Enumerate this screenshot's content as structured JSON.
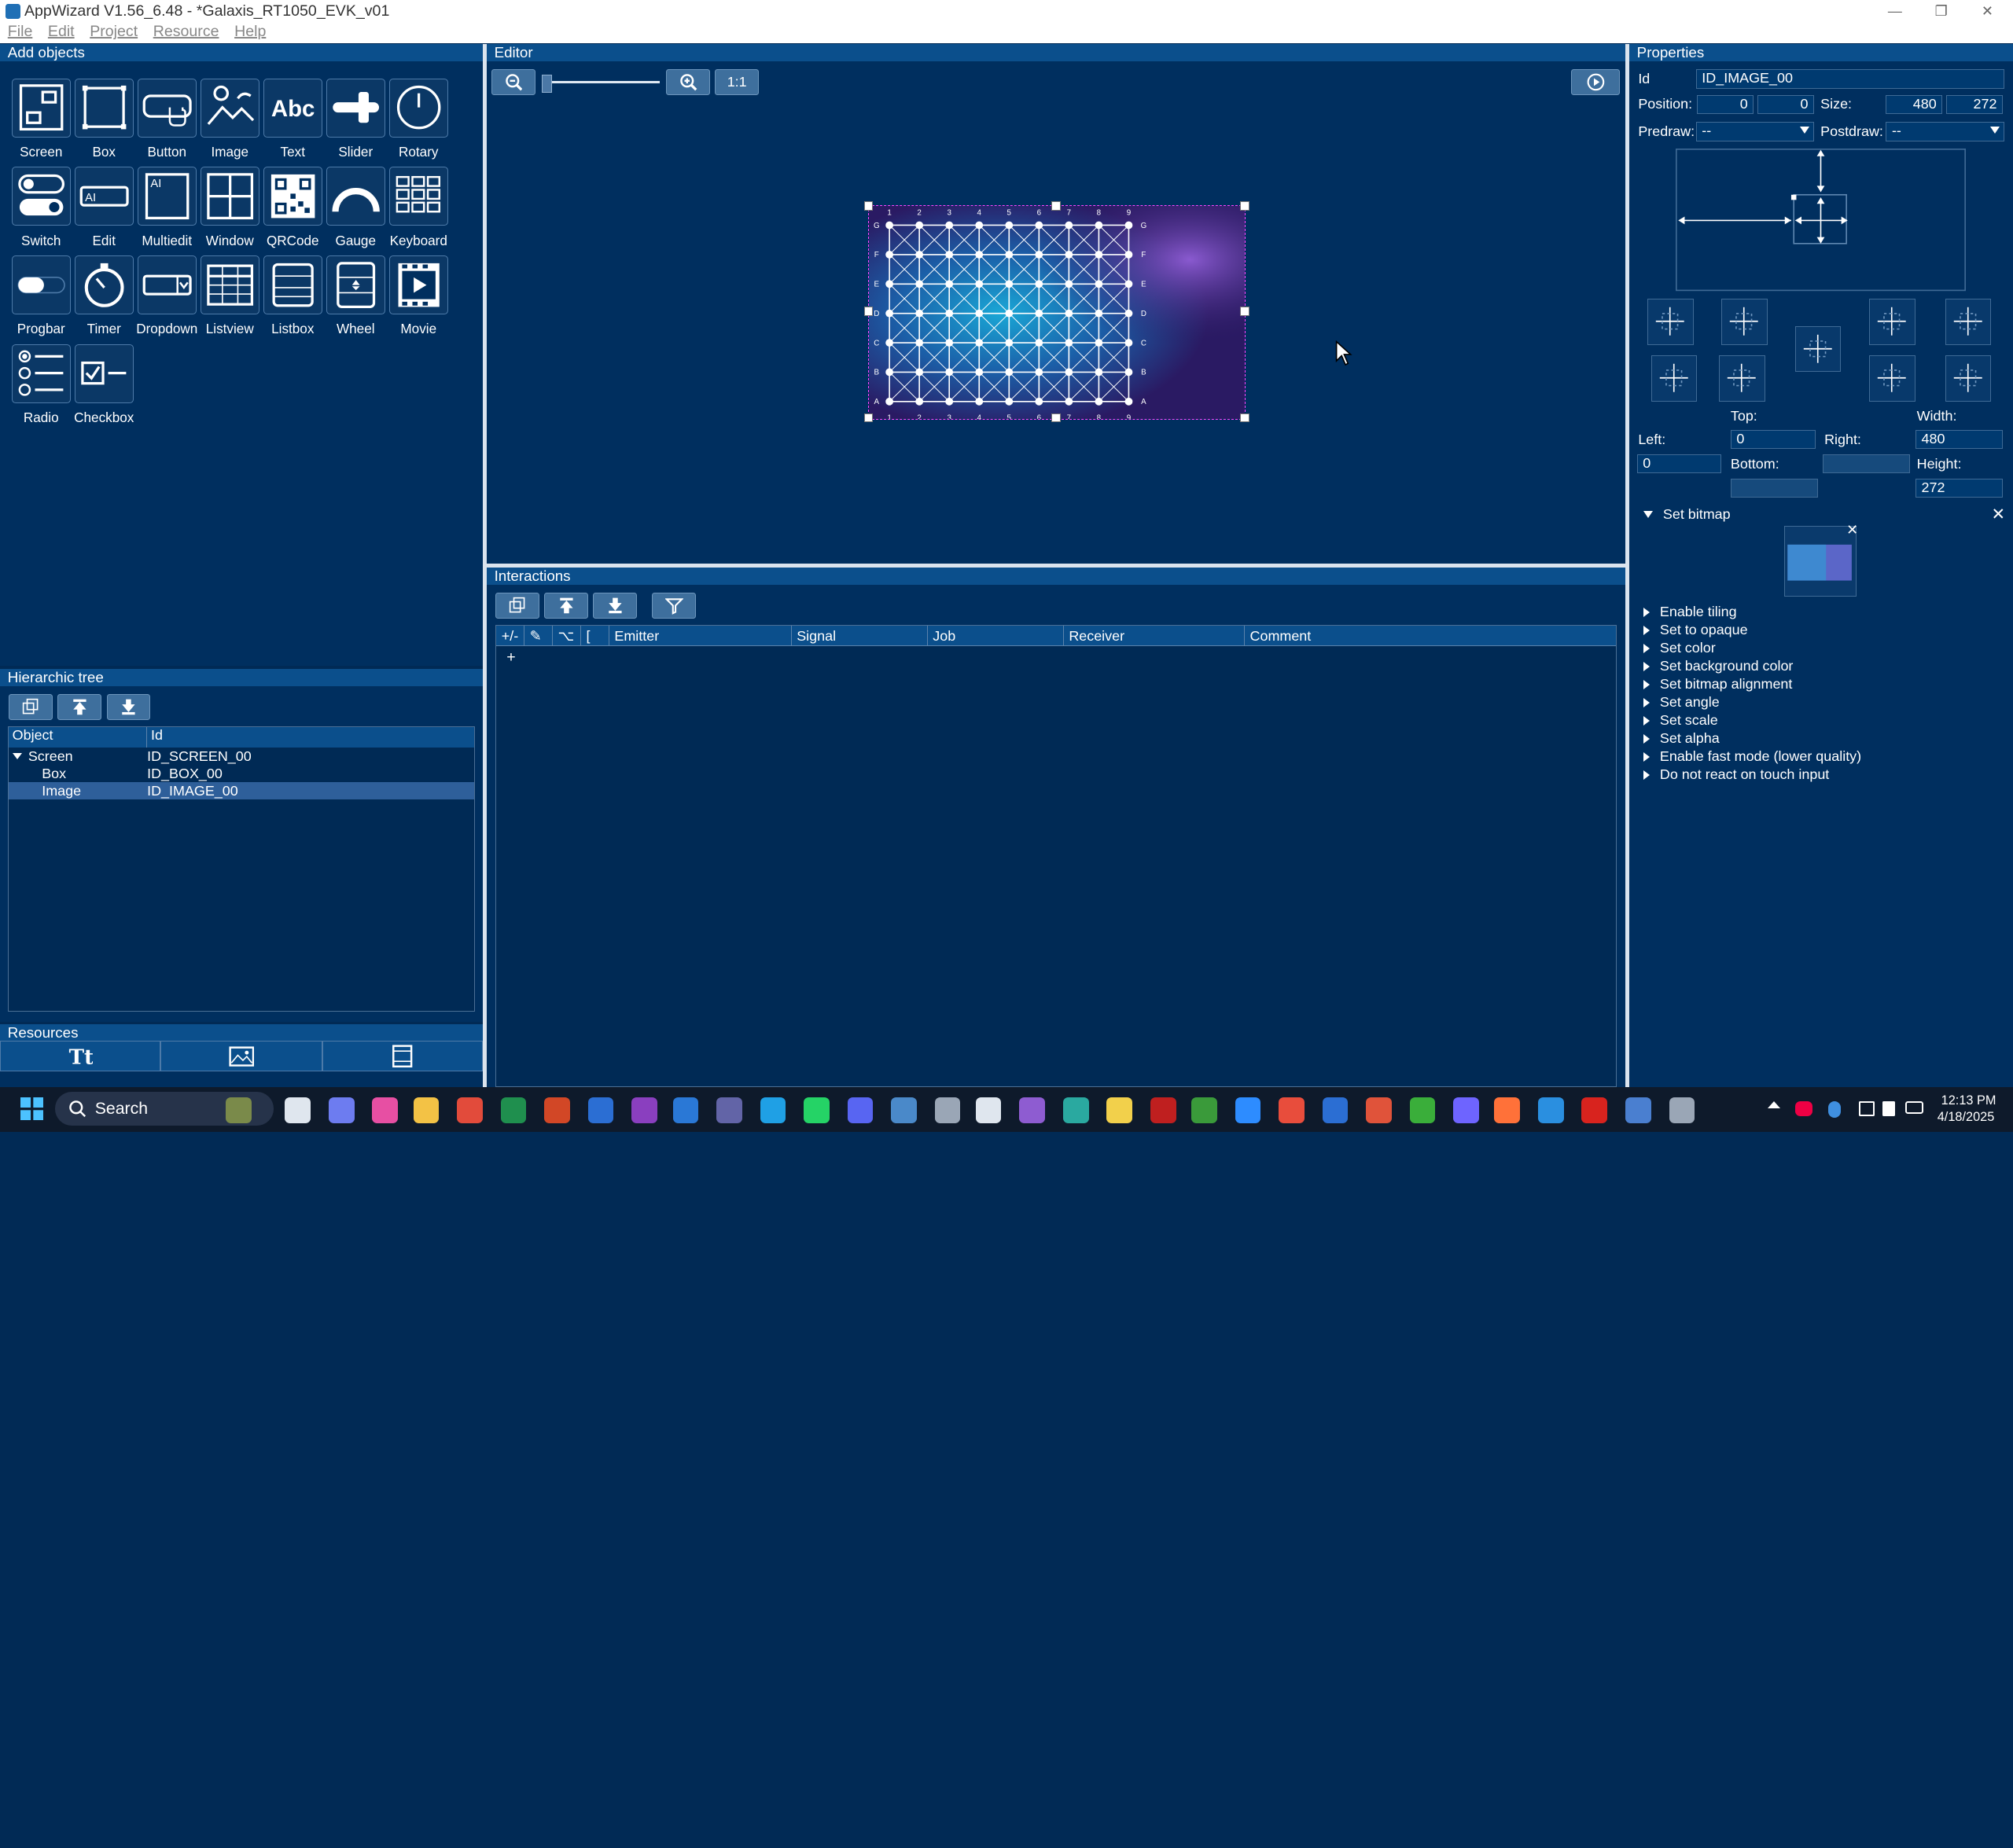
{
  "window": {
    "title": "AppWizard V1.56_6.48 - *Galaxis_RT1050_EVK_v01",
    "min": "—",
    "max": "❐",
    "close": "✕"
  },
  "menu": [
    "File",
    "Edit",
    "Project",
    "Resource",
    "Help"
  ],
  "add_objects": {
    "title": "Add objects",
    "tools": [
      "Screen",
      "Box",
      "Button",
      "Image",
      "Text",
      "Slider",
      "Rotary",
      "Switch",
      "Edit",
      "Multiedit",
      "Window",
      "QRCode",
      "Gauge",
      "Keyboard",
      "Progbar",
      "Timer",
      "Dropdown",
      "Listview",
      "Listbox",
      "Wheel",
      "Movie",
      "Radio",
      "Checkbox"
    ]
  },
  "tree": {
    "title": "Hierarchic tree",
    "cols": [
      "Object",
      "Id"
    ],
    "rows": [
      {
        "object": "Screen",
        "id": "ID_SCREEN_00",
        "expanded": true
      },
      {
        "object": "Box",
        "id": "ID_BOX_00"
      },
      {
        "object": "Image",
        "id": "ID_IMAGE_00",
        "selected": true
      }
    ]
  },
  "resources": {
    "title": "Resources"
  },
  "editor": {
    "title": "Editor",
    "zoom_reset": "1:1",
    "grid_cols": [
      "1",
      "2",
      "3",
      "4",
      "5",
      "6",
      "7",
      "8",
      "9"
    ],
    "grid_rows": [
      "G",
      "F",
      "E",
      "D",
      "C",
      "B",
      "A"
    ]
  },
  "interactions": {
    "title": "Interactions",
    "cols": [
      "+/-",
      "✎",
      "⌥",
      "[",
      "Emitter",
      "Signal",
      "Job",
      "Receiver",
      "Comment"
    ],
    "add_row": "+"
  },
  "properties": {
    "title": "Properties",
    "id_label": "Id",
    "id_value": "ID_IMAGE_00",
    "position_label": "Position:",
    "pos_x": "0",
    "pos_y": "0",
    "size_label": "Size:",
    "size_w": "480",
    "size_h": "272",
    "predraw_label": "Predraw:",
    "predraw_value": "--",
    "postdraw_label": "Postdraw:",
    "postdraw_value": "--",
    "top_label": "Top:",
    "left_label": "Left:",
    "right_label": "Right:",
    "bottom_label": "Bottom:",
    "width_label": "Width:",
    "height_label": "Height:",
    "top_value": "0",
    "left_value": "0",
    "width_value": "480",
    "height_value": "272",
    "set_bitmap": "Set bitmap",
    "sections": [
      "Enable tiling",
      "Set to opaque",
      "Set color",
      "Set background color",
      "Set bitmap alignment",
      "Set angle",
      "Set scale",
      "Set alpha",
      "Enable fast mode (lower quality)",
      "Do not react on touch input"
    ]
  },
  "taskbar": {
    "search": "Search",
    "time": "12:13 PM",
    "date": "4/18/2025"
  },
  "colors": {
    "panel": "#002f5f",
    "header": "#0b4f8c",
    "accent": "#2e5f9a",
    "selection_border": "#ff44ff"
  }
}
